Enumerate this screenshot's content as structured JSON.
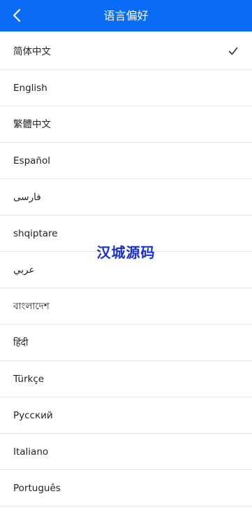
{
  "header": {
    "title": "语言偏好",
    "back_icon": "chevron-left-icon",
    "background_color": "#0a6cf5"
  },
  "languages": [
    {
      "label": "简体中文",
      "selected": true
    },
    {
      "label": "English",
      "selected": false
    },
    {
      "label": "繁體中文",
      "selected": false
    },
    {
      "label": "Español",
      "selected": false
    },
    {
      "label": "فارسی",
      "selected": false
    },
    {
      "label": "shqiptare",
      "selected": false
    },
    {
      "label": "عربي",
      "selected": false
    },
    {
      "label": "বাংলাদেশ",
      "selected": false
    },
    {
      "label": "हिंदी",
      "selected": false
    },
    {
      "label": "Türkçe",
      "selected": false
    },
    {
      "label": "Русский",
      "selected": false
    },
    {
      "label": "Italiano",
      "selected": false
    },
    {
      "label": "Português",
      "selected": false
    }
  ],
  "selected_icon": "checkmark-icon",
  "watermark": {
    "text": "汉城源码",
    "color": "#1a2fc8"
  }
}
